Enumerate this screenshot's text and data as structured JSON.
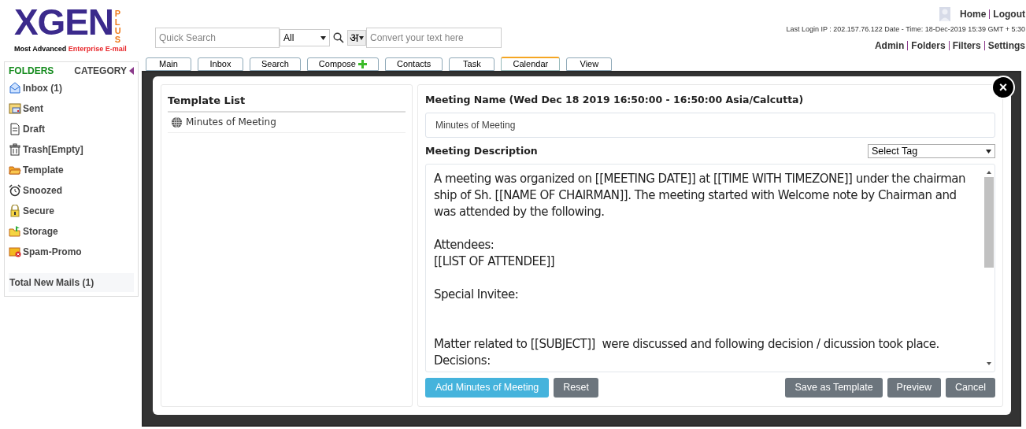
{
  "header": {
    "logo": {
      "name": "XGEN",
      "badge": "PLUS",
      "tagline_start": "Most Advanced ",
      "tagline_highlight": "Enterprise E-mail"
    },
    "search": {
      "placeholder": "Quick Search",
      "scope": "All",
      "script_glyph": "अ",
      "convert_placeholder": "Convert your text here"
    },
    "user_links": [
      "Home",
      "Logout"
    ],
    "last_login": "Last Login IP : 202.157.76.122 Date - Time: 18-Dec-2019 15:39 GMT + 5:30",
    "admin_links": [
      "Admin",
      "Folders",
      "Filters",
      "Settings"
    ]
  },
  "sidebar": {
    "heading": "FOLDERS",
    "category": "CATEGORY",
    "items": [
      {
        "kind": "inbox",
        "label": "Inbox",
        "count": "(1)"
      },
      {
        "kind": "sent",
        "label": "Sent"
      },
      {
        "kind": "draft",
        "label": "Draft"
      },
      {
        "kind": "trash",
        "label": "Trash[Empty]"
      },
      {
        "kind": "template",
        "label": "Template"
      },
      {
        "kind": "snoozed",
        "label": "Snoozed"
      },
      {
        "kind": "secure",
        "label": "Secure"
      },
      {
        "kind": "storage",
        "label": "Storage"
      },
      {
        "kind": "spam",
        "label": "Spam-Promo"
      }
    ],
    "total": "Total New Mails (1)"
  },
  "tabs": [
    {
      "label": "Main",
      "selected": false
    },
    {
      "label": "Inbox",
      "selected": false
    },
    {
      "label": "Search",
      "selected": false
    },
    {
      "label": "Compose",
      "selected": false,
      "plus": true
    },
    {
      "label": "Contacts",
      "selected": false
    },
    {
      "label": "Task",
      "selected": false
    },
    {
      "label": "Calendar",
      "selected": true
    },
    {
      "label": "View",
      "selected": false
    }
  ],
  "modal": {
    "close": "×",
    "template_list": {
      "title": "Template List",
      "items": [
        "Minutes of Meeting"
      ]
    },
    "meeting_name_label": "Meeting Name (Wed Dec 18 2019 16:50:00 - 16:50:00 Asia/Calcutta)",
    "meeting_name": "Minutes of Meeting",
    "description_label": "Meeting Description",
    "tag_select": "Select Tag",
    "description_blocks": [
      {
        "kind": "paragraph",
        "lines": [
          "A meeting was organized on [[MEETING DATE]] at [[TIME WITH TIMEZONE]] under the chairman ship of Sh. [[NAME OF CHAIRMAN]]. The meeting started with Welcome note by Chairman and was attended by the following."
        ]
      },
      {
        "kind": "paragraph",
        "lines": [
          "Attendees:",
          "[[LIST OF ATTENDEE]]"
        ]
      },
      {
        "kind": "field",
        "lines": [
          "Special Invitee:"
        ]
      },
      {
        "kind": "paragraph",
        "lines": [
          "Matter related to [[SUBJECT]]  were discussed and following decision / dicussion took place.",
          "Decisions:"
        ]
      }
    ],
    "buttons": [
      {
        "kind": "primary",
        "label": "Add Minutes of Meeting"
      },
      {
        "kind": "secondary",
        "label": "Reset"
      },
      {
        "kind": "spacer"
      },
      {
        "kind": "secondary",
        "label": "Save as Template"
      },
      {
        "kind": "secondary",
        "label": "Preview"
      },
      {
        "kind": "secondary",
        "label": "Cancel"
      }
    ]
  }
}
